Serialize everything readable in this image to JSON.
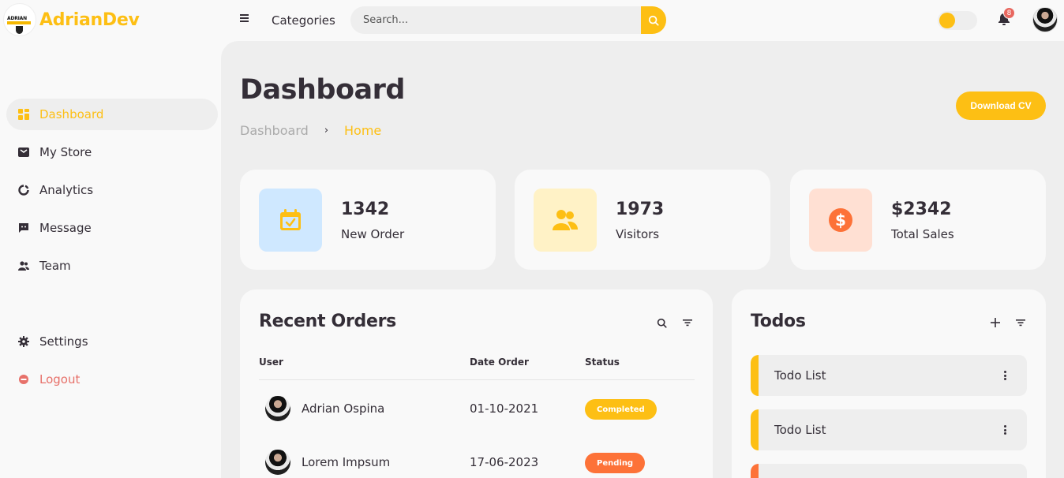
{
  "brand": {
    "logo_line": "ADRIAN",
    "name": "AdrianDev"
  },
  "topnav": {
    "categories_label": "Categories",
    "search_placeholder": "Search...",
    "notification_count": "8",
    "theme_toggle_on": true
  },
  "sidebar": {
    "items": [
      {
        "label": "Dashboard",
        "icon": "dashboard-icon",
        "active": true
      },
      {
        "label": "My Store",
        "icon": "store-icon"
      },
      {
        "label": "Analytics",
        "icon": "analytics-icon"
      },
      {
        "label": "Message",
        "icon": "message-icon"
      },
      {
        "label": "Team",
        "icon": "team-icon"
      }
    ],
    "settings_label": "Settings",
    "logout_label": "Logout"
  },
  "header": {
    "title": "Dashboard",
    "breadcrumb": [
      "Dashboard",
      "Home"
    ],
    "download_label": "Download CV"
  },
  "stats": [
    {
      "value": "1342",
      "label": "New Order",
      "icon": "calendar-check-icon",
      "color": "#cfe8ff",
      "icon_color": "#fdbf14"
    },
    {
      "value": "1973",
      "label": "Visitors",
      "icon": "users-icon",
      "color": "#fff2c6",
      "icon_color": "#fdbf14"
    },
    {
      "value": "$2342",
      "label": "Total Sales",
      "icon": "dollar-icon",
      "color": "#ffe0d3",
      "icon_color": "#fd7238"
    }
  ],
  "orders": {
    "title": "Recent Orders",
    "columns": [
      "User",
      "Date Order",
      "Status"
    ],
    "rows": [
      {
        "user": "Adrian Ospina",
        "date": "01-10-2021",
        "status": "Completed",
        "status_color": "#fdbf14"
      },
      {
        "user": "Lorem Impsum",
        "date": "17-06-2023",
        "status": "Pending",
        "status_color": "#fd7238"
      }
    ]
  },
  "todos": {
    "title": "Todos",
    "items": [
      {
        "label": "Todo List",
        "color": "#fdbf14"
      },
      {
        "label": "Todo List",
        "color": "#fdbf14"
      }
    ]
  },
  "colors": {
    "accent": "#fdbf14",
    "orange": "#fd7238",
    "dark": "#342e37",
    "light": "#f9f9f9",
    "grey": "#eeeeee"
  }
}
